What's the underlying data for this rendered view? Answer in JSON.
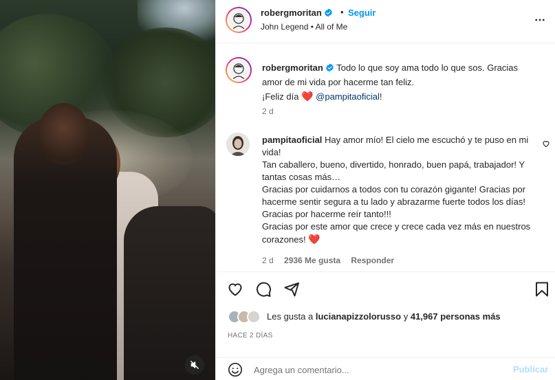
{
  "post": {
    "username": "robergmoritan",
    "follow_label": "Seguir",
    "separator": "•",
    "song": "John Legend • All of Me",
    "more_icon": "more-horizontal-icon"
  },
  "caption": {
    "username": "robergmoritan",
    "text_line1": "Todo lo que soy ama todo lo que sos. Gracias amor de mi vida por hacerme tan feliz.",
    "text_line2_prefix": "¡Feliz día",
    "heart": "❤️",
    "mention": "@pampitaoficial",
    "text_line2_suffix": "!",
    "time": "2 d"
  },
  "comment": {
    "username": "pampitaoficial",
    "p1": "Hay amor mío! El cielo me escuchó y te puso en mi vida!",
    "p2": "Tan caballero, bueno, divertido, honrado, buen papá, trabajador! Y tantas cosas más…",
    "p3": "Gracias por cuidarnos a todos con tu corazón gigante! Gracias por hacerme sentir segura a tu lado y abrazarme fuerte todos los días! Gracias por hacerme reír tanto!!!",
    "p4": "Gracias por este amor que crece y crece cada vez más en nuestros corazones!",
    "heart": "❤️",
    "time": "2 d",
    "likes": "2936 Me gusta",
    "reply": "Responder"
  },
  "actions": {
    "like_icon": "heart-icon",
    "comment_icon": "comment-icon",
    "share_icon": "share-icon",
    "save_icon": "bookmark-icon"
  },
  "likes": {
    "prefix": "Les gusta a",
    "user": "lucianapizzolorusso",
    "middle": "y",
    "count": "41,967 personas más"
  },
  "ago": "HACE 2 DÍAS",
  "add_comment": {
    "placeholder": "Agrega un comentario...",
    "post_label": "Publicar"
  },
  "colors": {
    "accent": "#0095f6",
    "heart": "#ed1c24",
    "mention": "#00376b",
    "muted": "#737373"
  }
}
